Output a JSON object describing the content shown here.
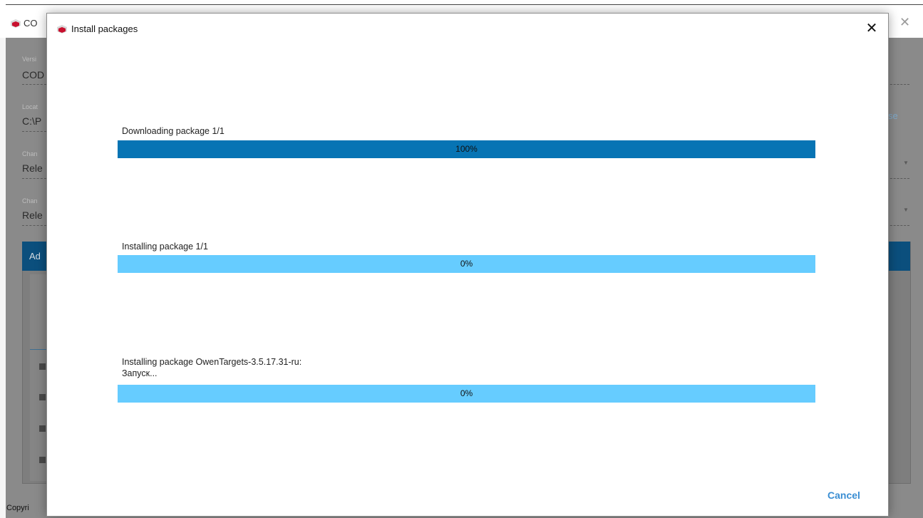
{
  "background_window": {
    "title": "CO",
    "fields": [
      {
        "label": "Versi",
        "value": "COD"
      },
      {
        "label": "Locat",
        "value": "C:\\P"
      },
      {
        "label": "Chan",
        "value": "Rele"
      },
      {
        "label": "Chan",
        "value": "Rele"
      }
    ],
    "side_text": "se",
    "panel_title": "Ad",
    "footer_text": "Copyri"
  },
  "dialog": {
    "title": "Install packages",
    "steps": [
      {
        "label": "Downloading package 1/1",
        "progress": 100,
        "text": "100%"
      },
      {
        "label": "Installing package 1/1",
        "progress": 0,
        "text": "0%"
      },
      {
        "label": "Installing package OwenTargets-3.5.17.31-ru:",
        "label2": "Запуск...",
        "progress": 0,
        "text": "0%"
      }
    ],
    "cancel_label": "Cancel"
  },
  "colors": {
    "bar_fill": "#0774b4",
    "bar_track": "#66ccff",
    "accent_link": "#3a8ed3",
    "logo_red": "#c8102e"
  },
  "icons": {
    "app_logo": "red-cube-logo-icon",
    "close": "close-icon"
  }
}
